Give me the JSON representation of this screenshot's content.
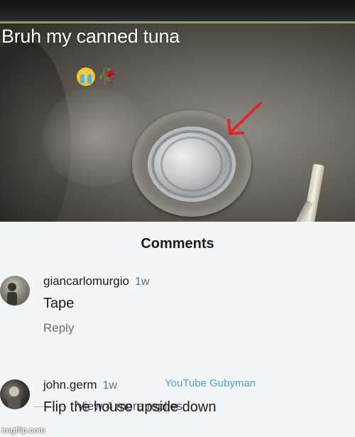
{
  "post": {
    "caption": "Bruh my canned tuna",
    "caption_emojis": [
      "crying-face",
      "wilted-rose"
    ]
  },
  "comments": {
    "title": "Comments",
    "items": [
      {
        "username": "giancarlomurgio",
        "timestamp": "1w",
        "text": "Tape",
        "reply_label": "Reply",
        "view_replies_label": "View 4 more replies"
      },
      {
        "username": "john.germ",
        "timestamp": "1w",
        "text": "Flip the house upside down"
      }
    ]
  },
  "overlays": {
    "youtube_watermark": "YouTube Gubyman",
    "imgflip_watermark": "imgflip.com"
  },
  "colors": {
    "panel_bg": "#f4f5f7",
    "arrow_red": "#e0252b",
    "watermark_blue": "#4aa3df"
  }
}
